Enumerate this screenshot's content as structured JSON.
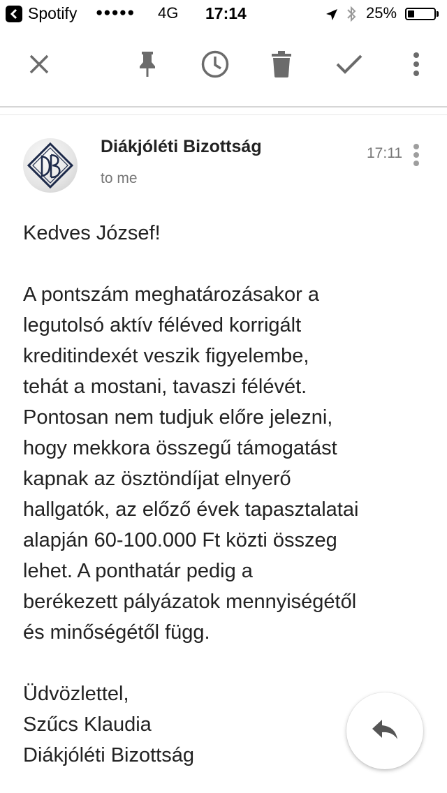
{
  "status_bar": {
    "back_app": "Spotify",
    "signal_dots": "●●●●●",
    "network": "4G",
    "time": "17:14",
    "battery_percent": "25%",
    "battery_level": 0.25
  },
  "toolbar": {
    "icons": [
      "close-icon",
      "pin-icon",
      "snooze-clock-icon",
      "trash-icon",
      "check-icon",
      "more-vert-icon"
    ]
  },
  "email": {
    "sender": "Diákjóléti Bizottság",
    "recipient": "to me",
    "time": "17:11",
    "greeting": "Kedves József!",
    "lines": [
      "A pontszám meghatározásakor a",
      "legutolsó aktív féléved korrigált",
      "kreditindexét veszik figyelembe,",
      "tehát a mostani, tavaszi félévét.",
      "Pontosan nem tudjuk előre jelezni,",
      "hogy mekkora összegű támogatást",
      "kapnak az ösztöndíjat elnyerő",
      "hallgatók, az előző évek tapasztalatai",
      "alapján 60-100.000 Ft közti összeg",
      "lehet. A ponthatár pedig a",
      "berékezett pályázatok mennyiségétől",
      "és minőségétől függ."
    ],
    "closing": "Üdvözlettel,",
    "signature_name": "Szűcs Klaudia",
    "signature_org": "Diákjóléti Bizottság"
  },
  "fab": {
    "icon": "reply-icon"
  }
}
